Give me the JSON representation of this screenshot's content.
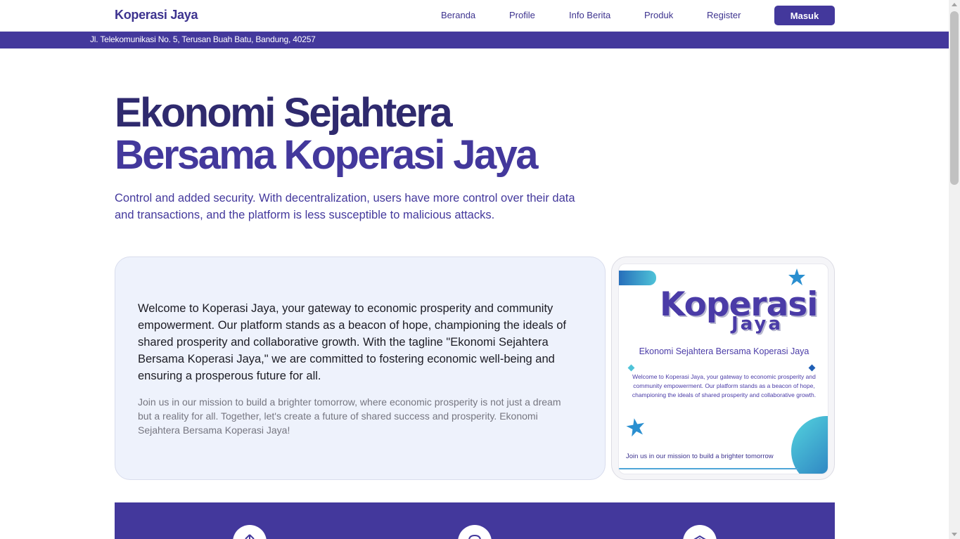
{
  "navbar": {
    "brand": "Koperasi Jaya",
    "links": [
      "Beranda",
      "Profile",
      "Info Berita",
      "Produk",
      "Register"
    ],
    "login_label": "Masuk"
  },
  "address": "Jl. Telekomunikasi No. 5, Terusan Buah Batu, Bandung, 40257",
  "hero": {
    "title_line1": "Ekonomi Sejahtera",
    "title_line2": "Bersama Koperasi Jaya",
    "subtitle": "Control and added security. With decentralization, users have more control over their data and transactions, and the platform is less susceptible to malicious attacks."
  },
  "welcome": {
    "main": "Welcome to Koperasi Jaya, your gateway to economic prosperity and community empowerment. Our platform stands as a beacon of hope, championing the ideals of shared prosperity and collaborative growth. With the tagline \"Ekonomi Sejahtera Bersama Koperasi Jaya,\" we are committed to fostering economic well-being and ensuring a prosperous future for all.",
    "join": "Join us in our mission to build a brighter tomorrow, where economic prosperity is not just a dream but a reality for all. Together, let's create a future of shared success and prosperity. Ekonomi Sejahtera Bersama Koperasi Jaya!"
  },
  "poster": {
    "title_part1": "Koperasi",
    "title_part2": "Jaya",
    "tagline": "Ekonomi Sejahtera Bersama Koperasi Jaya",
    "description": "Welcome to Koperasi Jaya, your gateway to economic prosperity and community empowerment. Our platform stands as a beacon of hope, championing the ideals of shared prosperity and collaborative growth.",
    "join": "Join us in our mission to build a brighter tomorrow"
  },
  "features": {
    "icons": [
      "upload-icon",
      "cloud-icon",
      "layers-icon"
    ]
  },
  "colors": {
    "primary": "#43389c",
    "title_dark": "#2f2a6e",
    "card_bg": "#eef2fc",
    "accent_teal": "#4fc3d8",
    "accent_blue": "#1f5fb5"
  }
}
